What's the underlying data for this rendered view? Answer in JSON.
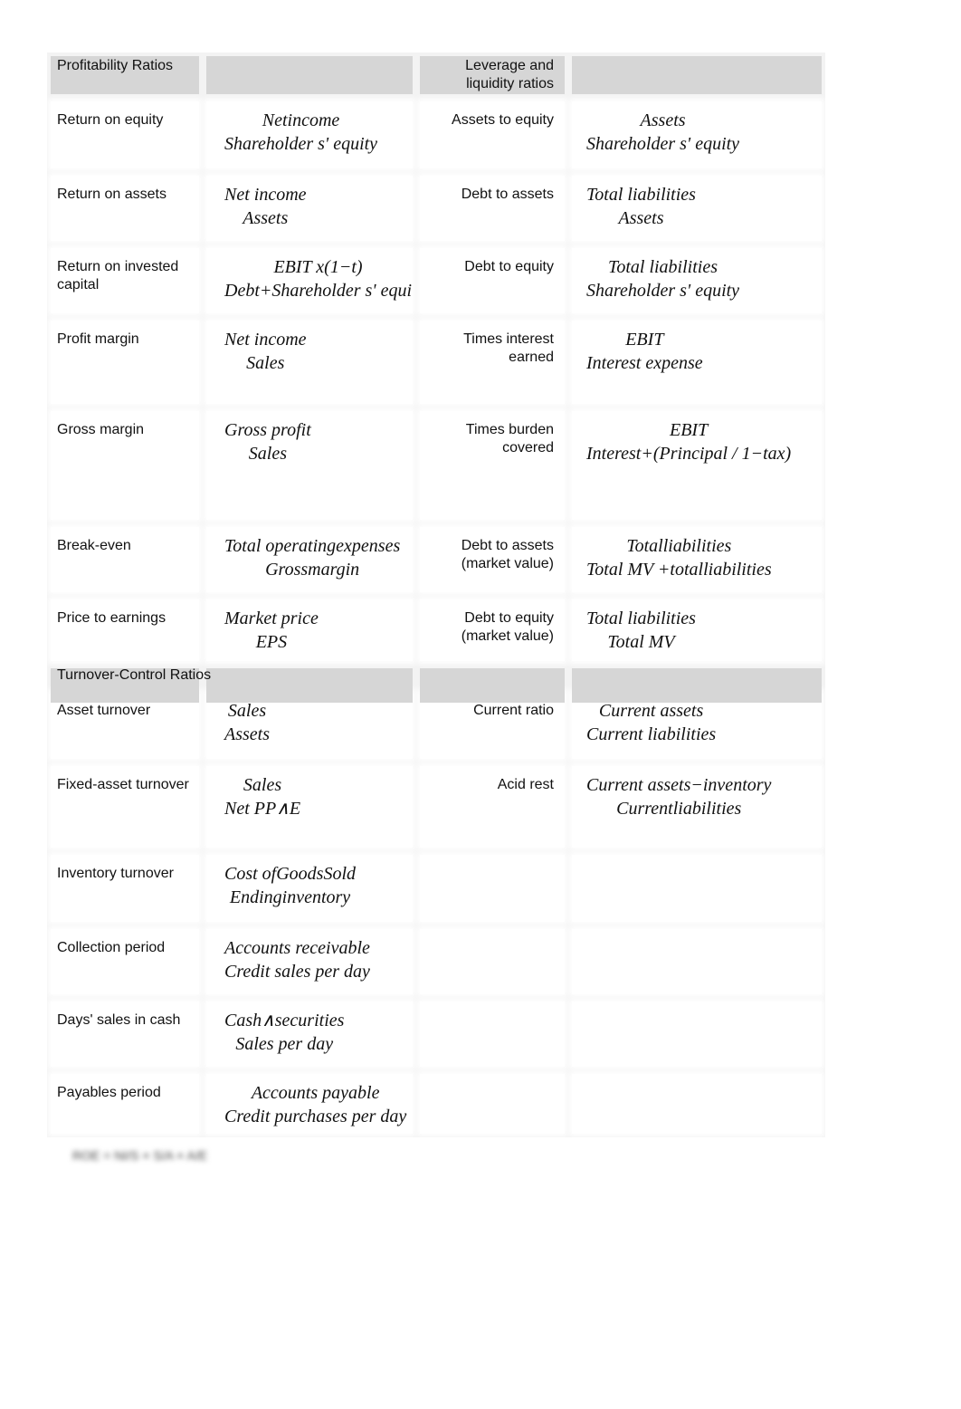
{
  "headers": {
    "left": "Profitability Ratios",
    "right": "Leverage and liquidity ratios",
    "turnover": "Turnover-Control Ratios"
  },
  "rows": [
    {
      "l": "Return on equity",
      "lf": [
        "Netincome",
        "Shareholder s' equity"
      ],
      "r": "Assets to equity",
      "rf": [
        "Assets",
        "Shareholder s' equity"
      ]
    },
    {
      "l": "Return on assets",
      "lf": [
        "Net income",
        "Assets"
      ],
      "r": "Debt to assets",
      "rf": [
        "Total liabilities",
        "Assets"
      ]
    },
    {
      "l": "Return on invested capital",
      "lf": [
        "EBIT x(1−t)",
        "Debt+Shareholder s' equi"
      ],
      "r": "Debt to equity",
      "rf": [
        "Total liabilities",
        "Shareholder s' equity"
      ]
    },
    {
      "l": "Profit margin",
      "lf": [
        "Net income",
        "Sales"
      ],
      "r": "Times interest earned",
      "rf": [
        "EBIT",
        "Interest expense"
      ]
    },
    {
      "l": "Gross margin",
      "lf": [
        "Gross profit",
        "Sales"
      ],
      "r": "Times burden covered",
      "rf": [
        "EBIT",
        "Interest+(Principal / 1−tax)"
      ]
    },
    {
      "l": "Break-even",
      "lf": [
        "Total operatingexpenses",
        "Grossmargin"
      ],
      "r": "Debt to assets (market value)",
      "rf": [
        "Totalliabilities",
        "Total MV +totalliabilities"
      ]
    },
    {
      "l": "Price to earnings",
      "lf": [
        "Market price",
        "EPS"
      ],
      "r": "Debt to equity (market value)",
      "rf": [
        "Total liabilities",
        "Total MV"
      ]
    },
    {
      "l": "Asset turnover",
      "lf": [
        "Sales",
        "Assets"
      ],
      "r": "Current ratio",
      "rf": [
        "Current assets",
        "Current liabilities"
      ]
    },
    {
      "l": "Fixed-asset turnover",
      "lf": [
        "Sales",
        "Net PP∧E"
      ],
      "r": "Acid rest",
      "rf": [
        "Current assets−inventory",
        "Currentliabilities"
      ]
    },
    {
      "l": "Inventory turnover",
      "lf": [
        "Cost ofGoodsSold",
        "Endinginventory"
      ],
      "r": "",
      "rf": [
        "",
        ""
      ]
    },
    {
      "l": "Collection period",
      "lf": [
        "Accounts receivable",
        "Credit sales per day"
      ],
      "r": "",
      "rf": [
        "",
        ""
      ]
    },
    {
      "l": "Days' sales in cash",
      "lf": [
        "Cash∧securities",
        "Sales per day"
      ],
      "r": "",
      "rf": [
        "",
        ""
      ]
    },
    {
      "l": "Payables period",
      "lf": [
        "Accounts payable",
        "Credit purchases per day"
      ],
      "r": "",
      "rf": [
        "",
        ""
      ]
    }
  ]
}
